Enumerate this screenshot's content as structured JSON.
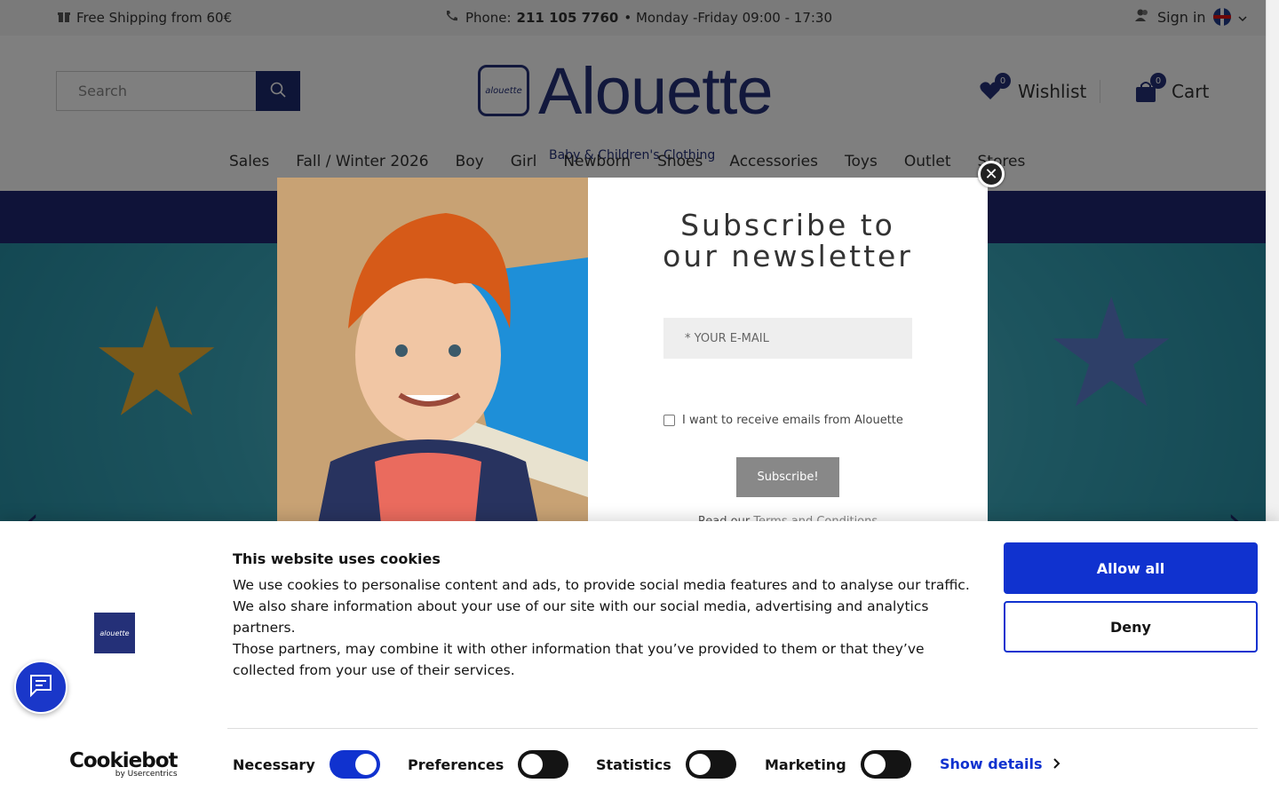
{
  "topbar": {
    "shipping": "Free Shipping from 60€",
    "phone_label": "Phone:",
    "phone_number": "211 105 7760",
    "hours": "• Monday -Friday 09:00 - 17:30",
    "signin": "Sign in"
  },
  "header": {
    "search_placeholder": "Search",
    "logo_text": "Alouette",
    "logo_mark": "alouette",
    "tagline": "Baby & Children's Clothing",
    "wishlist_label": "Wishlist",
    "wishlist_count": "0",
    "cart_label": "Cart",
    "cart_count": "0"
  },
  "nav": {
    "items": [
      "Sales",
      "Fall / Winter 2026",
      "Boy",
      "Girl",
      "Newborn",
      "Shoes",
      "Accessories",
      "Toys",
      "Outlet",
      "Stores"
    ]
  },
  "newsletter": {
    "title_line1": "Subscribe to",
    "title_line2": "our newsletter",
    "email_placeholder": "* YOUR E-MAIL",
    "consent_label": "I want to receive emails from Alouette",
    "subscribe_label": "Subscribe!",
    "terms_prefix": "Read our",
    "terms_link": "Terms and Conditions"
  },
  "cookie": {
    "title": "This website uses cookies",
    "paragraphs": [
      "We use cookies to personalise content and ads, to provide social media features and to analyse our traffic.",
      "We also share information about your use of our site with our social media, advertising and analytics partners.",
      "Those partners, may combine it with other information that you’ve provided to them or that they’ve collected from your use of their services."
    ],
    "allow_label": "Allow all",
    "deny_label": "Deny",
    "toggles": {
      "necessary": {
        "label": "Necessary",
        "on": true
      },
      "preferences": {
        "label": "Preferences",
        "on": false
      },
      "statistics": {
        "label": "Statistics",
        "on": false
      },
      "marketing": {
        "label": "Marketing",
        "on": false
      }
    },
    "show_details_label": "Show details",
    "brand_name": "Cookiebot",
    "brand_sub": "by Usercentrics"
  },
  "colors": {
    "brand_navy": "#243078",
    "banner_blue": "#1f2672",
    "cookie_accent": "#1032cf"
  },
  "icons": [
    "gift-icon",
    "phone-icon",
    "user-icon",
    "search-icon",
    "heart-icon",
    "bag-icon",
    "close-icon",
    "chevron-right-icon",
    "chat-icon"
  ]
}
